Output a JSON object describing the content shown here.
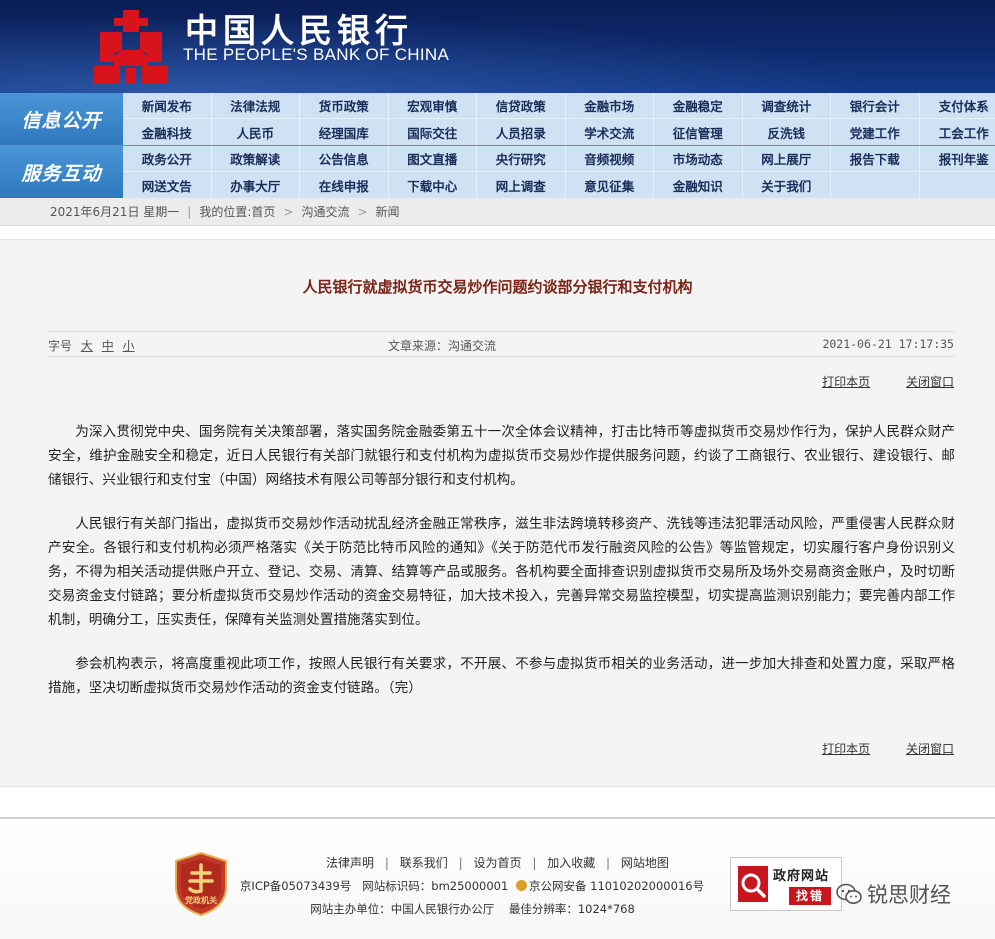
{
  "header": {
    "name_cn": "中国人民银行",
    "name_en": "THE PEOPLE'S BANK OF CHINA"
  },
  "nav": [
    {
      "label": "信息公开",
      "items": [
        "新闻发布",
        "法律法规",
        "货币政策",
        "宏观审慎",
        "信贷政策",
        "金融市场",
        "金融稳定",
        "调查统计",
        "银行会计",
        "支付体系",
        "金融科技",
        "人民币",
        "经理国库",
        "国际交往",
        "人员招录",
        "学术交流",
        "征信管理",
        "反洗钱",
        "党建工作",
        "工会工作"
      ]
    },
    {
      "label": "服务互动",
      "items": [
        "政务公开",
        "政策解读",
        "公告信息",
        "图文直播",
        "央行研究",
        "音频视频",
        "市场动态",
        "网上展厅",
        "报告下载",
        "报刊年鉴",
        "网送文告",
        "办事大厅",
        "在线申报",
        "下载中心",
        "网上调查",
        "意见征集",
        "金融知识",
        "关于我们",
        "",
        ""
      ]
    }
  ],
  "breadcrumb": {
    "date": "2021年6月21日 星期一",
    "location_prefix": "我的位置:",
    "items": [
      "首页",
      "沟通交流",
      "新闻"
    ]
  },
  "article": {
    "title": "人民银行就虚拟货币交易炒作问题约谈部分银行和支付机构",
    "font_label": "字号",
    "font_sizes": [
      "大",
      "中",
      "小"
    ],
    "source": "文章来源：沟通交流",
    "datetime": "2021-06-21 17:17:35",
    "print_label": "打印本页",
    "close_label": "关闭窗口",
    "paragraphs": [
      "为深入贯彻党中央、国务院有关决策部署，落实国务院金融委第五十一次全体会议精神，打击比特币等虚拟货币交易炒作行为，保护人民群众财产安全，维护金融安全和稳定，近日人民银行有关部门就银行和支付机构为虚拟货币交易炒作提供服务问题，约谈了工商银行、农业银行、建设银行、邮储银行、兴业银行和支付宝（中国）网络技术有限公司等部分银行和支付机构。",
      "人民银行有关部门指出，虚拟货币交易炒作活动扰乱经济金融正常秩序，滋生非法跨境转移资产、洗钱等违法犯罪活动风险，严重侵害人民群众财产安全。各银行和支付机构必须严格落实《关于防范比特币风险的通知》《关于防范代币发行融资风险的公告》等监管规定，切实履行客户身份识别义务，不得为相关活动提供账户开立、登记、交易、清算、结算等产品或服务。各机构要全面排查识别虚拟货币交易所及场外交易商资金账户，及时切断交易资金支付链路；要分析虚拟货币交易炒作活动的资金交易特征，加大技术投入，完善异常交易监控模型，切实提高监测识别能力；要完善内部工作机制，明确分工，压实责任，保障有关监测处置措施落实到位。",
      "参会机构表示，将高度重视此项工作，按照人民银行有关要求，不开展、不参与虚拟货币相关的业务活动，进一步加大排查和处置力度，采取严格措施，坚决切断虚拟货币交易炒作活动的资金支付链路。（完）"
    ]
  },
  "footer": {
    "links": [
      "法律声明",
      "联系我们",
      "设为首页",
      "加入收藏",
      "网站地图"
    ],
    "icp": "京ICP备05073439号",
    "site_id": "网站标识码：bm25000001",
    "police": "京公网安备 11010202000016号",
    "host": "网站主办单位：中国人民银行办公厅",
    "resolution": "最佳分辨率：1024*768",
    "badge_text": "党政机关",
    "gov_title": "政府网站",
    "gov_find": "找错",
    "watermark": "锐思财经"
  },
  "colors": {
    "header_bg": "#0d2a6e",
    "nav_label_bg": "#3a86cc",
    "nav_bg": "#cfe2f3",
    "title_color": "#7a2418",
    "logo_red": "#d8131c"
  }
}
